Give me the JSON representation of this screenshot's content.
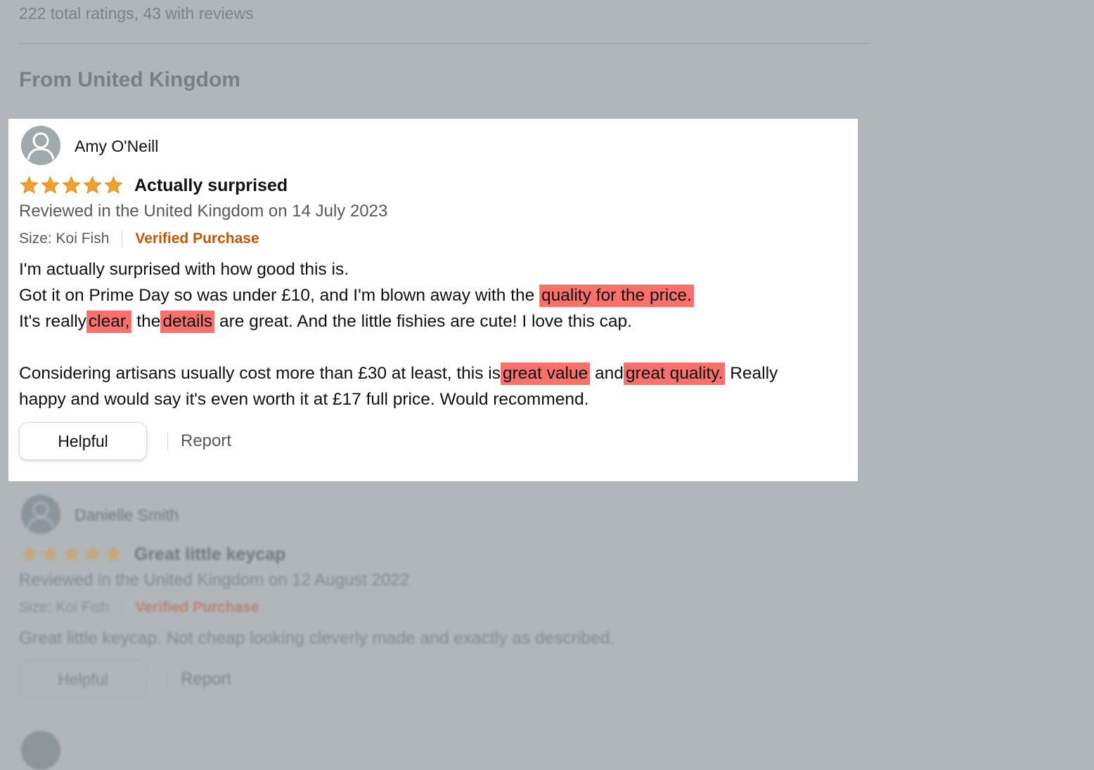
{
  "summary": {
    "ratings_text": "222 total ratings, 43 with reviews",
    "section_title": "From United Kingdom"
  },
  "review_1": {
    "reviewer": "Amy O'Neill",
    "rating": 5,
    "title": "Actually surprised",
    "date_text": "Reviewed in the United Kingdom on 14 July 2023",
    "size_label": "Size: Koi Fish",
    "verified_label": "Verified Purchase",
    "body": {
      "line1": "I'm actually surprised with how good this is.",
      "line2_pre": "Got it on Prime Day so was under £10, and I'm blown away with the",
      "line2_hl": "quality for the price.",
      "line3_pre": "It's really",
      "line3_hl1": "clear,",
      "line3_mid": "the",
      "line3_hl2": "details",
      "line3_post": "are great. And the little fishies are cute! I love this cap.",
      "line4_pre": "Considering artisans usually cost more than £30 at least, this is",
      "line4_hl1": "great value",
      "line4_mid": "and",
      "line4_hl2": "great quality.",
      "line4_post": "Really",
      "line5": "happy and would say it's even worth it at £17 full price. Would recommend."
    },
    "helpful_label": "Helpful",
    "report_label": "Report"
  },
  "review_2": {
    "reviewer": "Danielle Smith",
    "rating": 5,
    "title": "Great little keycap",
    "date_text": "Reviewed in the United Kingdom on 12 August 2022",
    "size_label": "Size: Koi Fish",
    "verified_label": "Verified Purchase",
    "body": "Great little keycap. Not cheap looking cleverly made and exactly as described.",
    "helpful_label": "Helpful",
    "report_label": "Report"
  },
  "colors": {
    "overlay": "#b1b6ba",
    "star": "#f4a12b",
    "verified": "#c45500",
    "highlight": "#f8716c"
  }
}
